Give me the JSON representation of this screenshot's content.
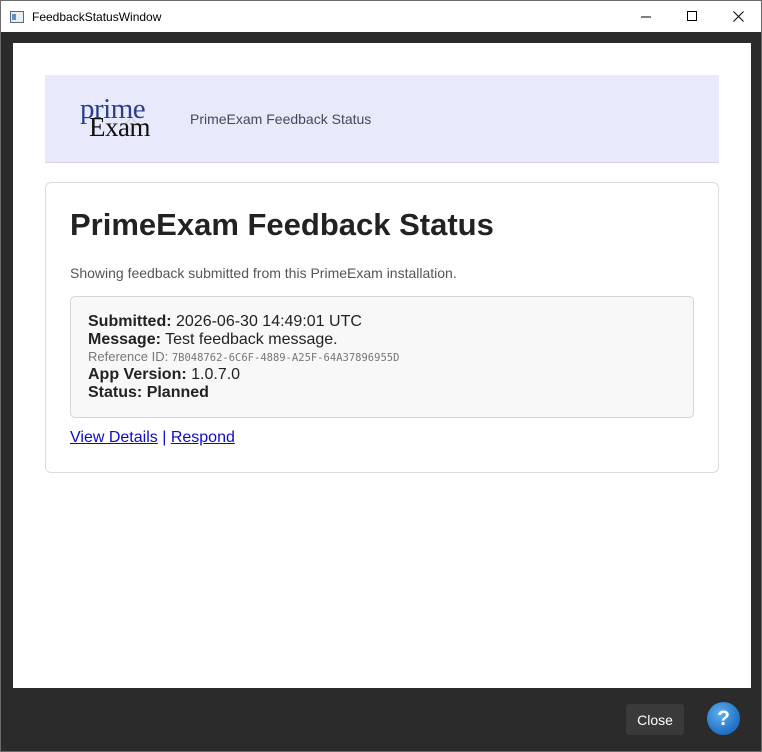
{
  "window": {
    "title": "FeedbackStatusWindow",
    "icon": "window-icon"
  },
  "banner": {
    "logo_primary": "prime",
    "logo_secondary": "Exam",
    "title": "PrimeExam Feedback Status"
  },
  "card": {
    "heading": "PrimeExam Feedback Status",
    "description": "Showing feedback submitted from this PrimeExam installation.",
    "submitted_label": "Submitted:",
    "submitted_value": "2026-06-30 14:49:01 UTC",
    "message_label": "Message:",
    "message_value": "Test feedback message.",
    "reference_label": "Reference ID:",
    "reference_value": "7B048762-6C6F-4889-A25F-64A37896955D",
    "version_label": "App Version:",
    "version_value": "1.0.7.0",
    "status_label": "Status:",
    "status_value": "Planned",
    "link_details": "View Details",
    "link_separator": "|",
    "link_respond": "Respond"
  },
  "footer": {
    "close_label": "Close",
    "help_label": "?"
  },
  "colors": {
    "banner_bg": "#e8e9fb",
    "link": "#0b0bcc",
    "chrome_dark": "#2b2b2b",
    "help_blue": "#1f6fc4"
  }
}
